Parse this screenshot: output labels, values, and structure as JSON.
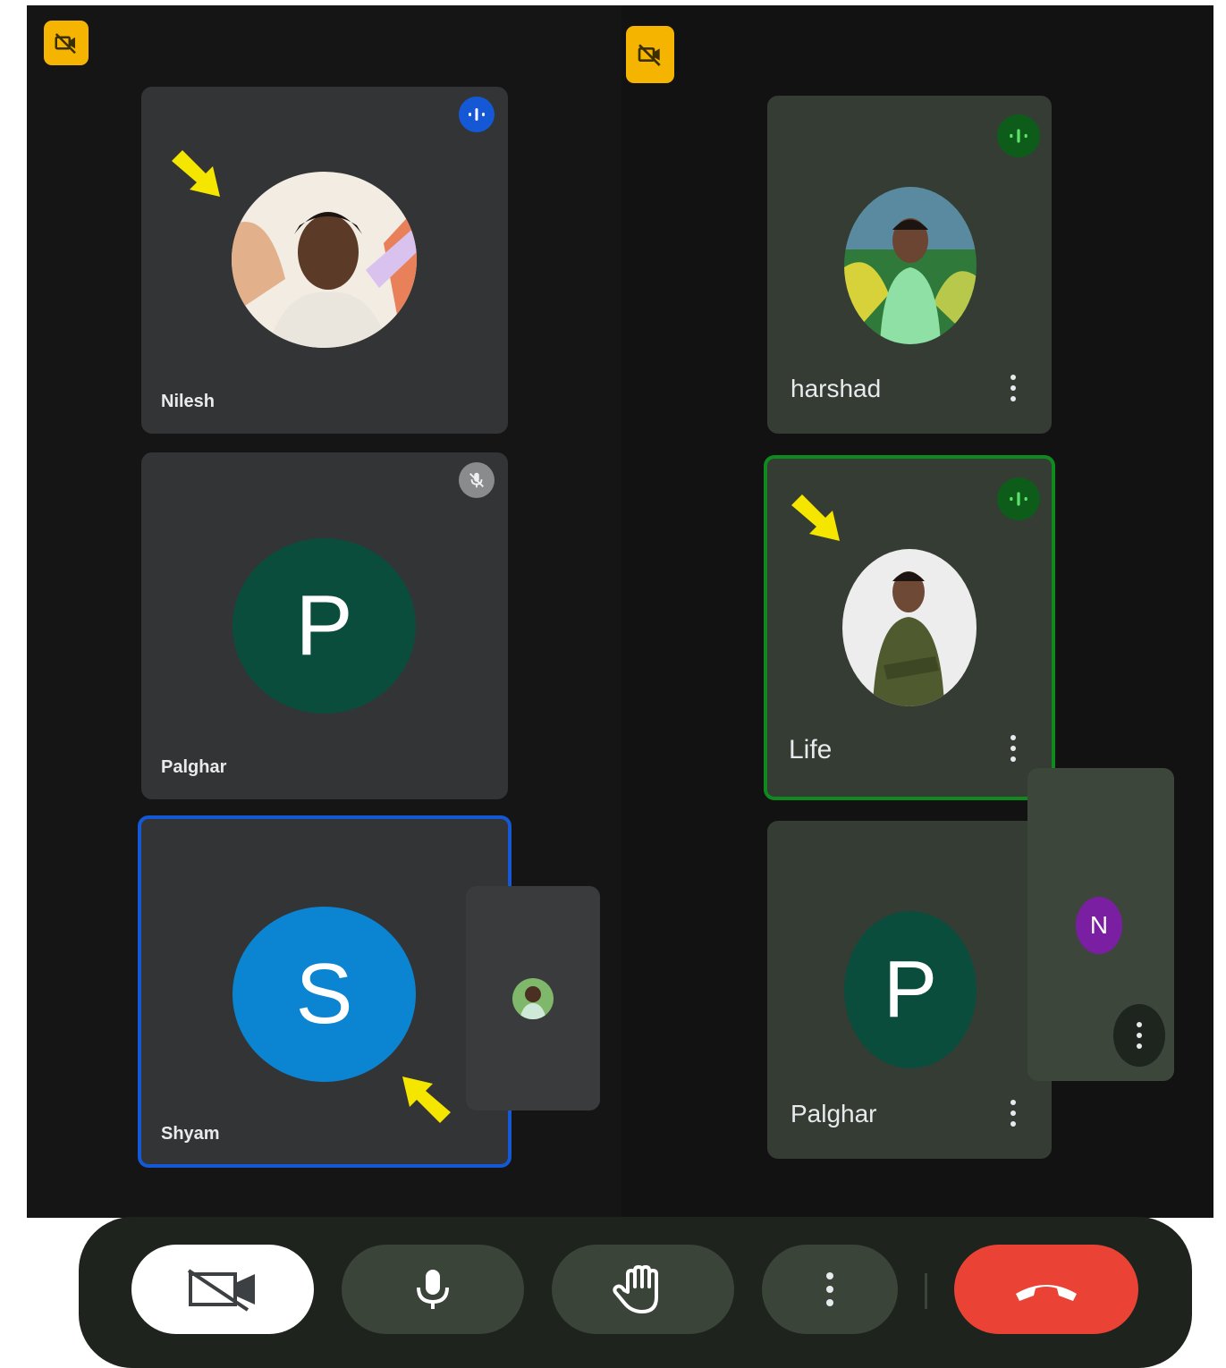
{
  "left_panel": {
    "tiles": [
      {
        "name": "Nilesh",
        "audio": "speaking",
        "avatar": "photo"
      },
      {
        "name": "Palghar",
        "audio": "muted",
        "avatar_letter": "P"
      },
      {
        "name": "Shyam",
        "avatar_letter": "S",
        "active_speaker": true
      }
    ],
    "self_view": {
      "avatar": "photo"
    }
  },
  "right_panel": {
    "tiles": [
      {
        "name": "harshad",
        "audio": "speaking",
        "avatar": "photo"
      },
      {
        "name": "Life",
        "audio": "speaking",
        "avatar": "photo",
        "active_speaker": true
      },
      {
        "name": "Palghar",
        "avatar_letter": "P"
      }
    ],
    "self_view": {
      "avatar_letter": "N"
    }
  },
  "controls": [
    {
      "id": "camera",
      "icon": "video-off-icon",
      "state": "off"
    },
    {
      "id": "microphone",
      "icon": "microphone-icon"
    },
    {
      "id": "raise-hand",
      "icon": "hand-icon"
    },
    {
      "id": "more",
      "icon": "more-vertical-icon"
    },
    {
      "id": "end-call",
      "icon": "phone-hangup-icon"
    }
  ],
  "colors": {
    "camera_off_badge": "#f4b400",
    "avatar_p": "#0b4d3c",
    "avatar_s": "#0b84d1",
    "avatar_n": "#7b1fa2",
    "speaking_blue": "#1558d6",
    "speaking_green": "#0f8a1e",
    "end_call": "#ea4335",
    "annotation_arrow": "#f5e600"
  }
}
